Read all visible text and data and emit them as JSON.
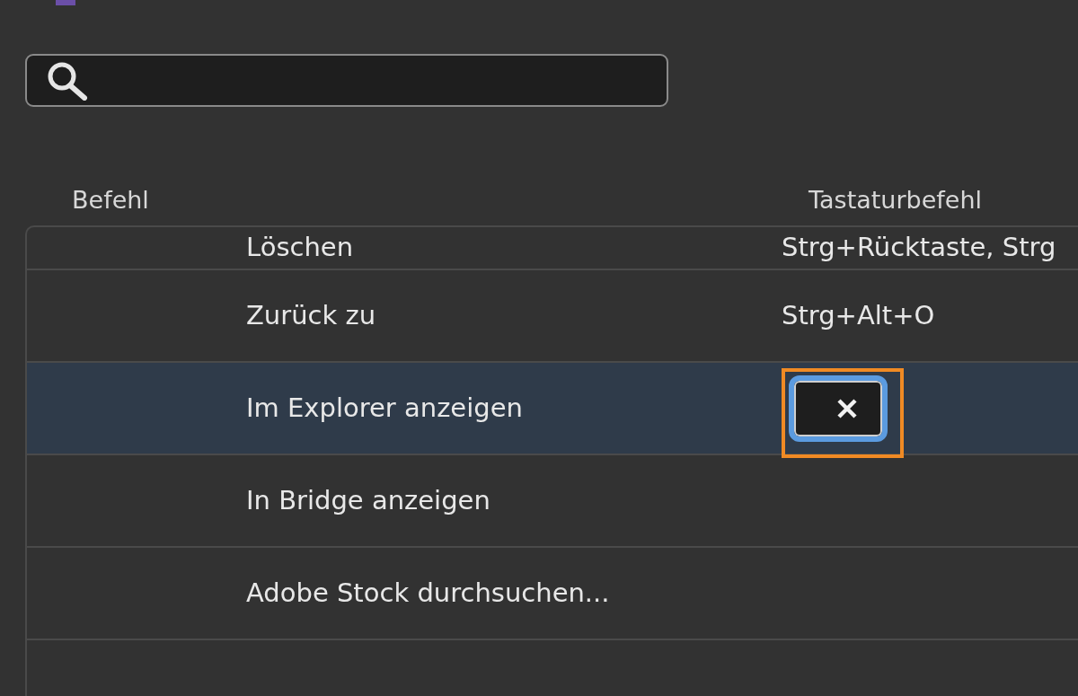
{
  "columns": [
    "Befehl",
    "Tastaturbefehl"
  ],
  "rows": [
    {
      "kind": "cut",
      "command": "Löschen",
      "shortcut": "Strg+Rücktaste, Strg",
      "selected": false
    },
    {
      "kind": "normal",
      "command": "Zurück zu",
      "shortcut": "Strg+Alt+O",
      "selected": false
    },
    {
      "kind": "editing",
      "command": "Im Explorer anzeigen",
      "shortcut": "",
      "selected": true,
      "highlighted": true
    },
    {
      "kind": "normal",
      "command": "In Bridge anzeigen",
      "shortcut": "",
      "selected": false
    },
    {
      "kind": "normal",
      "command": "Adobe Stock durchsuchen...",
      "shortcut": "",
      "selected": false
    },
    {
      "kind": "blank",
      "command": "",
      "shortcut": "",
      "selected": false
    }
  ]
}
